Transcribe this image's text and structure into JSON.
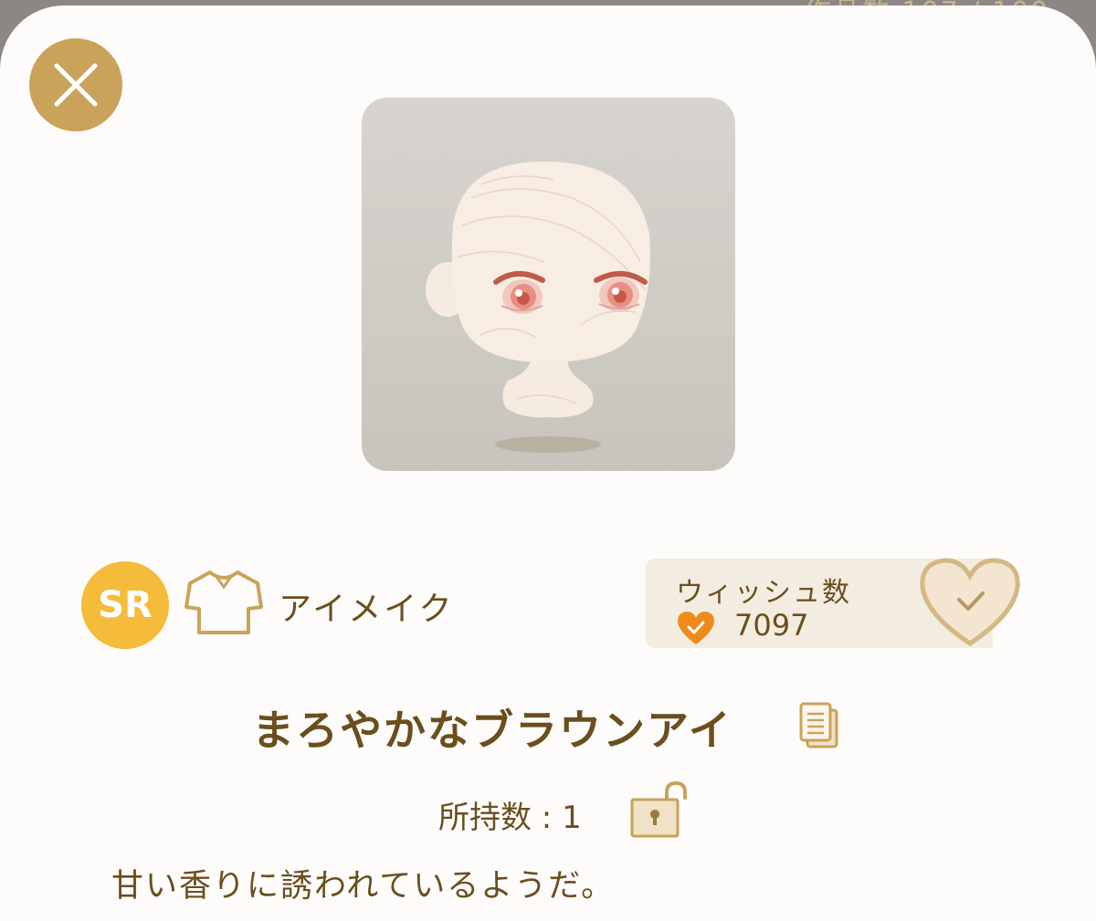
{
  "item": {
    "rarity": "SR",
    "category_icon": "shirt-icon",
    "category_label": "アイメイク",
    "name": "まろやかなブラウンアイ",
    "owned_label": "所持数 : 1",
    "description": "甘い香りに誘われているようだ。"
  },
  "wish": {
    "title": "ウィッシュ数",
    "count": "7097"
  },
  "icons": {
    "close": "close-icon",
    "copy": "copy-icon",
    "lock": "unlocked-padlock-icon",
    "wish_heart": "heart-check-icon"
  },
  "colors": {
    "accent_gold": "#c9a35a",
    "rarity_yellow": "#f5bb3a",
    "text_brown": "#6b4e1e",
    "heart_orange": "#f08a1c"
  }
}
